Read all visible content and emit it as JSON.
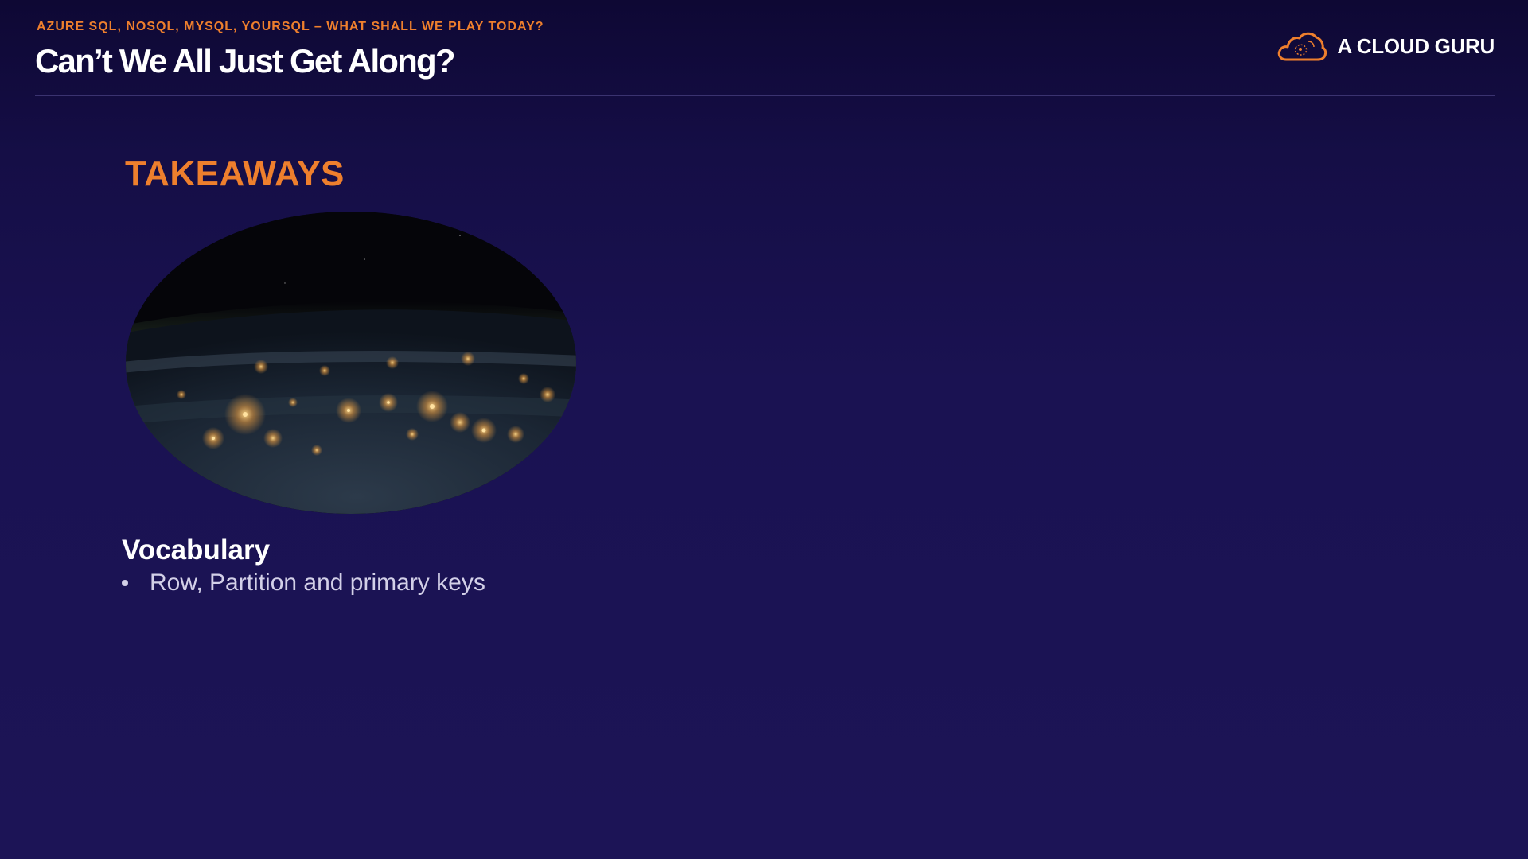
{
  "header": {
    "eyebrow": "AZURE SQL, NOSQL, MYSQL, YOURSQL – WHAT SHALL WE PLAY TODAY?",
    "title": "Can’t We All Just Get Along?"
  },
  "brand": {
    "logo_icon": "cloud-logo-icon",
    "name": "A CLOUD GURU"
  },
  "colors": {
    "accent": "#ee7f2d",
    "background": "#1a1252",
    "text": "#ffffff",
    "body_text": "#d3d0e8"
  },
  "content": {
    "section_heading": "TAKEAWAYS",
    "image": "earth-at-night-photo",
    "vocabulary_heading": "Vocabulary",
    "bullets": [
      "Row, Partition and primary keys"
    ]
  }
}
